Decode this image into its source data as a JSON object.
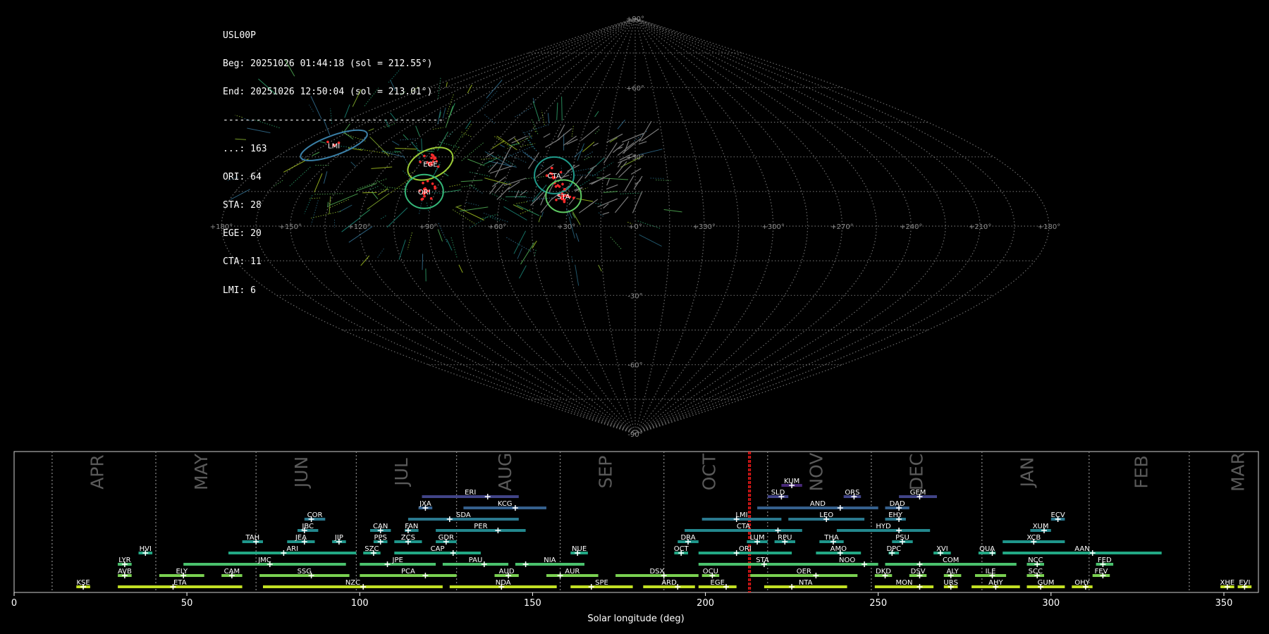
{
  "info": {
    "station": "USL00P",
    "beg": "Beg: 20251026 01:44:18 (sol = 212.55°)",
    "end": "End: 20251026 12:50:04 (sol = 213.01°)",
    "separator": "----------------------------------------",
    "counts": [
      "...: 163",
      "ORI: 64",
      "STA: 28",
      "EGE: 20",
      "CTA: 11",
      "LMI: 6"
    ]
  },
  "sky_map": {
    "lon_labels": [
      "+180°",
      "+150°",
      "+120°",
      "+90°",
      "+60°",
      "+30°",
      "+0°",
      "+330°",
      "+300°",
      "+270°",
      "+240°",
      "+210°",
      "+180°"
    ],
    "lat_labels": [
      "+90°",
      "+60°",
      "+30°",
      "-30°",
      "-60°",
      "-90°"
    ],
    "radiants": [
      {
        "code": "LMI",
        "colour": "#3a7fa6",
        "lon": 160,
        "lat": 35,
        "count": 6
      },
      {
        "code": "EGE",
        "colour": "#9ccc35",
        "lon": 100,
        "lat": 27,
        "count": 20
      },
      {
        "code": "CTA",
        "colour": "#1f9a8a",
        "lon": 38,
        "lat": 22,
        "count": 11
      },
      {
        "code": "ORI",
        "colour": "#35b779",
        "lon": 95,
        "lat": 15,
        "count": 64
      },
      {
        "code": "STA",
        "colour": "#5ec962",
        "lon": 32,
        "lat": 13,
        "count": 28
      }
    ]
  },
  "chart_data": {
    "type": "timeline",
    "xlabel": "Solar longitude (deg)",
    "xlim": [
      0,
      360
    ],
    "xticks": [
      0,
      50,
      100,
      150,
      200,
      250,
      300,
      350
    ],
    "current_sol": [
      212.55,
      213.01
    ],
    "months": [
      {
        "label": "APR",
        "start": 11,
        "center": 24
      },
      {
        "label": "MAY",
        "start": 41,
        "center": 54
      },
      {
        "label": "JUN",
        "start": 70,
        "center": 83
      },
      {
        "label": "JUL",
        "start": 99,
        "center": 112
      },
      {
        "label": "AUG",
        "start": 128,
        "center": 142
      },
      {
        "label": "SEP",
        "start": 158,
        "center": 171
      },
      {
        "label": "OCT",
        "start": 188,
        "center": 201
      },
      {
        "label": "NOV",
        "start": 218,
        "center": 232
      },
      {
        "label": "DEC",
        "start": 248,
        "center": 261
      },
      {
        "label": "JAN",
        "start": 280,
        "center": 293
      },
      {
        "label": "FEB",
        "start": 311,
        "center": 326
      },
      {
        "label": "MAR",
        "start": 340,
        "center": 354
      }
    ],
    "showers": [
      {
        "code": "KUM",
        "start": 222,
        "end": 228,
        "peak": 225,
        "row": 10
      },
      {
        "code": "ERI",
        "start": 118,
        "end": 146,
        "peak": 137,
        "row": 9
      },
      {
        "code": "SLD",
        "start": 218,
        "end": 224,
        "peak": 222,
        "row": 9
      },
      {
        "code": "ORS",
        "start": 240,
        "end": 245,
        "peak": 243,
        "row": 9
      },
      {
        "code": "GEM",
        "start": 256,
        "end": 267,
        "peak": 262,
        "row": 9
      },
      {
        "code": "JXA",
        "start": 117,
        "end": 121,
        "peak": 119,
        "row": 8
      },
      {
        "code": "KCG",
        "start": 130,
        "end": 154,
        "peak": 145,
        "row": 8
      },
      {
        "code": "AND",
        "start": 215,
        "end": 250,
        "peak": 239,
        "row": 8
      },
      {
        "code": "DAD",
        "start": 252,
        "end": 259,
        "peak": 256,
        "row": 8
      },
      {
        "code": "COR",
        "start": 84,
        "end": 90,
        "peak": 86,
        "row": 7
      },
      {
        "code": "SDA",
        "start": 114,
        "end": 146,
        "peak": 126,
        "row": 7
      },
      {
        "code": "LMI",
        "start": 199,
        "end": 222,
        "peak": 209,
        "row": 7
      },
      {
        "code": "LEO",
        "start": 224,
        "end": 246,
        "peak": 235,
        "row": 7
      },
      {
        "code": "EHY",
        "start": 252,
        "end": 258,
        "peak": 256,
        "row": 7
      },
      {
        "code": "ECV",
        "start": 300,
        "end": 304,
        "peak": 302,
        "row": 7
      },
      {
        "code": "JBC",
        "start": 82,
        "end": 88,
        "peak": 84,
        "row": 6
      },
      {
        "code": "CAN",
        "start": 103,
        "end": 109,
        "peak": 106,
        "row": 6
      },
      {
        "code": "FAN",
        "start": 113,
        "end": 117,
        "peak": 114,
        "row": 6
      },
      {
        "code": "PER",
        "start": 122,
        "end": 148,
        "peak": 140,
        "row": 6
      },
      {
        "code": "CTA",
        "start": 194,
        "end": 228,
        "peak": 221,
        "row": 6
      },
      {
        "code": "HYD",
        "start": 238,
        "end": 265,
        "peak": 256,
        "row": 6
      },
      {
        "code": "XUM",
        "start": 294,
        "end": 300,
        "peak": 298,
        "row": 6
      },
      {
        "code": "TAH",
        "start": 66,
        "end": 72,
        "peak": 70,
        "row": 5
      },
      {
        "code": "JEA",
        "start": 79,
        "end": 87,
        "peak": 84,
        "row": 5
      },
      {
        "code": "JIP",
        "start": 92,
        "end": 96,
        "peak": 94,
        "row": 5
      },
      {
        "code": "PPS",
        "start": 104,
        "end": 108,
        "peak": 106,
        "row": 5
      },
      {
        "code": "ZCS",
        "start": 110,
        "end": 118,
        "peak": 114,
        "row": 5
      },
      {
        "code": "GDR",
        "start": 122,
        "end": 128,
        "peak": 125,
        "row": 5
      },
      {
        "code": "DRA",
        "start": 192,
        "end": 198,
        "peak": 195,
        "row": 5
      },
      {
        "code": "LUM",
        "start": 212,
        "end": 218,
        "peak": 215,
        "row": 5
      },
      {
        "code": "RPU",
        "start": 220,
        "end": 226,
        "peak": 223,
        "row": 5
      },
      {
        "code": "THA",
        "start": 233,
        "end": 240,
        "peak": 237,
        "row": 5
      },
      {
        "code": "PSU",
        "start": 254,
        "end": 260,
        "peak": 257,
        "row": 5
      },
      {
        "code": "XCB",
        "start": 286,
        "end": 304,
        "peak": 295,
        "row": 5
      },
      {
        "code": "HVI",
        "start": 36,
        "end": 40,
        "peak": 38,
        "row": 4
      },
      {
        "code": "ARI",
        "start": 62,
        "end": 99,
        "peak": 78,
        "row": 4
      },
      {
        "code": "SZC",
        "start": 101,
        "end": 106,
        "peak": 104,
        "row": 4
      },
      {
        "code": "CAP",
        "start": 110,
        "end": 135,
        "peak": 127,
        "row": 4
      },
      {
        "code": "NUE",
        "start": 161,
        "end": 166,
        "peak": 163,
        "row": 4
      },
      {
        "code": "OCT",
        "start": 191,
        "end": 195,
        "peak": 193,
        "row": 4
      },
      {
        "code": "ORI",
        "start": 198,
        "end": 225,
        "peak": 209,
        "row": 4
      },
      {
        "code": "AMO",
        "start": 232,
        "end": 245,
        "peak": 239,
        "row": 4
      },
      {
        "code": "DPC",
        "start": 253,
        "end": 256,
        "peak": 254,
        "row": 4
      },
      {
        "code": "XVI",
        "start": 266,
        "end": 271,
        "peak": 268,
        "row": 4
      },
      {
        "code": "QUA",
        "start": 279,
        "end": 284,
        "peak": 283,
        "row": 4
      },
      {
        "code": "AAN",
        "start": 286,
        "end": 332,
        "peak": 312,
        "row": 4
      },
      {
        "code": "LYR",
        "start": 30,
        "end": 34,
        "peak": 32,
        "row": 3
      },
      {
        "code": "JMC",
        "start": 49,
        "end": 96,
        "peak": 74,
        "row": 3
      },
      {
        "code": "JPE",
        "start": 100,
        "end": 122,
        "peak": 108,
        "row": 3
      },
      {
        "code": "PAU",
        "start": 124,
        "end": 143,
        "peak": 136,
        "row": 3
      },
      {
        "code": "NIA",
        "start": 145,
        "end": 165,
        "peak": 148,
        "row": 3
      },
      {
        "code": "STA",
        "start": 198,
        "end": 235,
        "peak": 217,
        "row": 3
      },
      {
        "code": "NOO",
        "start": 232,
        "end": 250,
        "peak": 246,
        "row": 3
      },
      {
        "code": "COM",
        "start": 252,
        "end": 290,
        "peak": 262,
        "row": 3
      },
      {
        "code": "NCC",
        "start": 293,
        "end": 298,
        "peak": 296,
        "row": 3
      },
      {
        "code": "FED",
        "start": 313,
        "end": 318,
        "peak": 315,
        "row": 3
      },
      {
        "code": "AVB",
        "start": 30,
        "end": 34,
        "peak": 32,
        "row": 2
      },
      {
        "code": "ELY",
        "start": 42,
        "end": 55,
        "peak": 49,
        "row": 2
      },
      {
        "code": "CAM",
        "start": 60,
        "end": 66,
        "peak": 63,
        "row": 2
      },
      {
        "code": "SSG",
        "start": 71,
        "end": 97,
        "peak": 86,
        "row": 2
      },
      {
        "code": "PCA",
        "start": 100,
        "end": 128,
        "peak": 119,
        "row": 2
      },
      {
        "code": "AUD",
        "start": 139,
        "end": 146,
        "peak": 143,
        "row": 2
      },
      {
        "code": "AUR",
        "start": 154,
        "end": 169,
        "peak": 158,
        "row": 2
      },
      {
        "code": "DSX",
        "start": 174,
        "end": 198,
        "peak": 188,
        "row": 2
      },
      {
        "code": "OCU",
        "start": 199,
        "end": 204,
        "peak": 202,
        "row": 2
      },
      {
        "code": "OER",
        "start": 213,
        "end": 244,
        "peak": 232,
        "row": 2
      },
      {
        "code": "DKD",
        "start": 249,
        "end": 254,
        "peak": 252,
        "row": 2
      },
      {
        "code": "DSV",
        "start": 259,
        "end": 264,
        "peak": 262,
        "row": 2
      },
      {
        "code": "ALY",
        "start": 269,
        "end": 274,
        "peak": 271,
        "row": 2
      },
      {
        "code": "ILE",
        "start": 278,
        "end": 287,
        "peak": 283,
        "row": 2
      },
      {
        "code": "SCC",
        "start": 293,
        "end": 298,
        "peak": 296,
        "row": 2
      },
      {
        "code": "FEV",
        "start": 312,
        "end": 317,
        "peak": 315,
        "row": 2
      },
      {
        "code": "KSE",
        "start": 18,
        "end": 22,
        "peak": 20,
        "row": 1
      },
      {
        "code": "ETA",
        "start": 30,
        "end": 66,
        "peak": 46,
        "row": 1
      },
      {
        "code": "NZC",
        "start": 72,
        "end": 124,
        "peak": 101,
        "row": 1
      },
      {
        "code": "NDA",
        "start": 126,
        "end": 157,
        "peak": 141,
        "row": 1
      },
      {
        "code": "SPE",
        "start": 161,
        "end": 179,
        "peak": 167,
        "row": 1
      },
      {
        "code": "ARD",
        "start": 182,
        "end": 197,
        "peak": 192,
        "row": 1
      },
      {
        "code": "EGE",
        "start": 198,
        "end": 209,
        "peak": 206,
        "row": 1
      },
      {
        "code": "NTA",
        "start": 217,
        "end": 241,
        "peak": 225,
        "row": 1
      },
      {
        "code": "MON",
        "start": 249,
        "end": 266,
        "peak": 262,
        "row": 1
      },
      {
        "code": "URS",
        "start": 269,
        "end": 273,
        "peak": 271,
        "row": 1
      },
      {
        "code": "AHY",
        "start": 277,
        "end": 291,
        "peak": 284,
        "row": 1
      },
      {
        "code": "GUM",
        "start": 293,
        "end": 304,
        "peak": 297,
        "row": 1
      },
      {
        "code": "OHY",
        "start": 306,
        "end": 312,
        "peak": 310,
        "row": 1
      },
      {
        "code": "XHE",
        "start": 349,
        "end": 353,
        "peak": 351,
        "row": 1
      },
      {
        "code": "EVI",
        "start": 354,
        "end": 358,
        "peak": 356,
        "row": 1
      }
    ]
  }
}
